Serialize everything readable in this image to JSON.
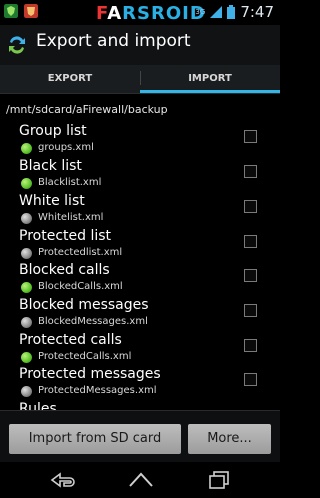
{
  "status": {
    "time": "7:47",
    "network": "3G"
  },
  "brand": {
    "part1": "F",
    "part2": "A",
    "part3": "RSROID"
  },
  "header": {
    "title": "Export and import"
  },
  "tabs": [
    {
      "label": "EXPORT"
    },
    {
      "label": "IMPORT"
    }
  ],
  "path": "/mnt/sdcard/aFirewall/backup",
  "items": [
    {
      "name": "Group list",
      "file": "groups.xml",
      "state": "green"
    },
    {
      "name": "Black list",
      "file": "Blacklist.xml",
      "state": "green"
    },
    {
      "name": "White list",
      "file": "Whitelist.xml",
      "state": "gray"
    },
    {
      "name": "Protected list",
      "file": "Protectedlist.xml",
      "state": "gray"
    },
    {
      "name": "Blocked calls",
      "file": "BlockedCalls.xml",
      "state": "green"
    },
    {
      "name": "Blocked messages",
      "file": "BlockedMessages.xml",
      "state": "gray"
    },
    {
      "name": "Protected calls",
      "file": "ProtectedCalls.xml",
      "state": "green"
    },
    {
      "name": "Protected messages",
      "file": "ProtectedMessages.xml",
      "state": "gray"
    },
    {
      "name": "Rules",
      "file": "",
      "state": "gray"
    }
  ],
  "buttons": {
    "import": "Import from SD card",
    "more": "More..."
  },
  "colors": {
    "accent": "#33b5e5",
    "active_dot": "#5cc22a",
    "inactive_dot": "#8a8a8a"
  }
}
